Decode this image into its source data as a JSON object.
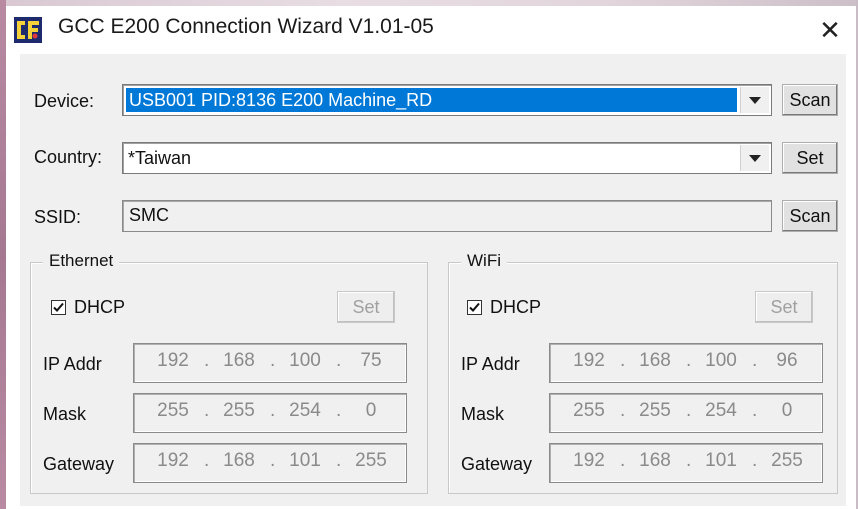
{
  "window": {
    "title": "GCC E200 Connection Wizard V1.01-05",
    "close_glyph": "✕"
  },
  "device": {
    "label": "Device:",
    "value": "USB001 PID:8136 E200 Machine_RD",
    "scan_label": "Scan"
  },
  "country": {
    "label": "Country:",
    "value": "*Taiwan",
    "set_label": "Set"
  },
  "ssid": {
    "label": "SSID:",
    "value": "SMC",
    "scan_label": "Scan"
  },
  "ethernet": {
    "title": "Ethernet",
    "dhcp_label": "DHCP",
    "dhcp_checked": true,
    "set_label": "Set",
    "ip_label": "IP Addr",
    "mask_label": "Mask",
    "gateway_label": "Gateway",
    "ip": [
      "192",
      "168",
      "100",
      "75"
    ],
    "mask": [
      "255",
      "255",
      "254",
      "0"
    ],
    "gateway": [
      "192",
      "168",
      "101",
      "255"
    ]
  },
  "wifi": {
    "title": "WiFi",
    "dhcp_label": "DHCP",
    "dhcp_checked": true,
    "set_label": "Set",
    "ip_label": "IP Addr",
    "mask_label": "Mask",
    "gateway_label": "Gateway",
    "ip": [
      "192",
      "168",
      "100",
      "96"
    ],
    "mask": [
      "255",
      "255",
      "254",
      "0"
    ],
    "gateway": [
      "192",
      "168",
      "101",
      "255"
    ]
  },
  "colors": {
    "selection": "#0078d7",
    "dialog_bg": "#f0f0f0",
    "disabled_text": "#8a8a8a"
  },
  "icons": {
    "app": "gcc-app-icon",
    "close": "close-icon",
    "dropdown": "chevron-down-icon",
    "checkbox": "checkmark-icon"
  }
}
